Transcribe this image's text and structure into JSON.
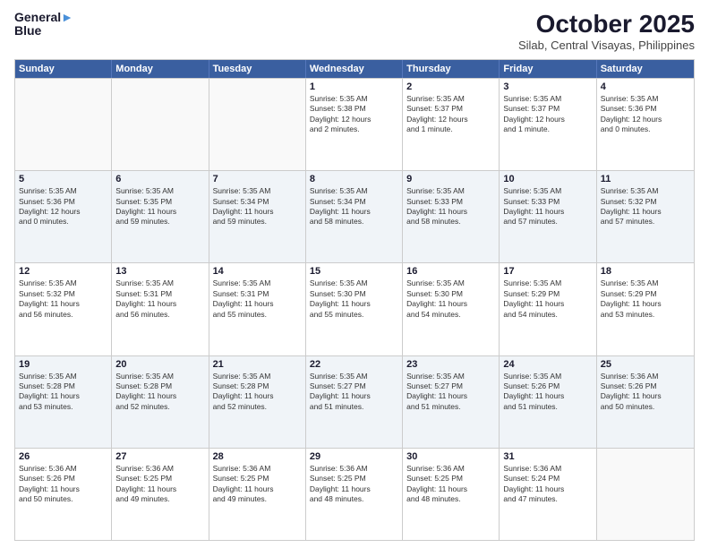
{
  "header": {
    "logo_line1": "General",
    "logo_line2": "Blue",
    "month": "October 2025",
    "location": "Silab, Central Visayas, Philippines"
  },
  "weekdays": [
    "Sunday",
    "Monday",
    "Tuesday",
    "Wednesday",
    "Thursday",
    "Friday",
    "Saturday"
  ],
  "rows": [
    [
      {
        "day": "",
        "info": ""
      },
      {
        "day": "",
        "info": ""
      },
      {
        "day": "",
        "info": ""
      },
      {
        "day": "1",
        "info": "Sunrise: 5:35 AM\nSunset: 5:38 PM\nDaylight: 12 hours\nand 2 minutes."
      },
      {
        "day": "2",
        "info": "Sunrise: 5:35 AM\nSunset: 5:37 PM\nDaylight: 12 hours\nand 1 minute."
      },
      {
        "day": "3",
        "info": "Sunrise: 5:35 AM\nSunset: 5:37 PM\nDaylight: 12 hours\nand 1 minute."
      },
      {
        "day": "4",
        "info": "Sunrise: 5:35 AM\nSunset: 5:36 PM\nDaylight: 12 hours\nand 0 minutes."
      }
    ],
    [
      {
        "day": "5",
        "info": "Sunrise: 5:35 AM\nSunset: 5:36 PM\nDaylight: 12 hours\nand 0 minutes."
      },
      {
        "day": "6",
        "info": "Sunrise: 5:35 AM\nSunset: 5:35 PM\nDaylight: 11 hours\nand 59 minutes."
      },
      {
        "day": "7",
        "info": "Sunrise: 5:35 AM\nSunset: 5:34 PM\nDaylight: 11 hours\nand 59 minutes."
      },
      {
        "day": "8",
        "info": "Sunrise: 5:35 AM\nSunset: 5:34 PM\nDaylight: 11 hours\nand 58 minutes."
      },
      {
        "day": "9",
        "info": "Sunrise: 5:35 AM\nSunset: 5:33 PM\nDaylight: 11 hours\nand 58 minutes."
      },
      {
        "day": "10",
        "info": "Sunrise: 5:35 AM\nSunset: 5:33 PM\nDaylight: 11 hours\nand 57 minutes."
      },
      {
        "day": "11",
        "info": "Sunrise: 5:35 AM\nSunset: 5:32 PM\nDaylight: 11 hours\nand 57 minutes."
      }
    ],
    [
      {
        "day": "12",
        "info": "Sunrise: 5:35 AM\nSunset: 5:32 PM\nDaylight: 11 hours\nand 56 minutes."
      },
      {
        "day": "13",
        "info": "Sunrise: 5:35 AM\nSunset: 5:31 PM\nDaylight: 11 hours\nand 56 minutes."
      },
      {
        "day": "14",
        "info": "Sunrise: 5:35 AM\nSunset: 5:31 PM\nDaylight: 11 hours\nand 55 minutes."
      },
      {
        "day": "15",
        "info": "Sunrise: 5:35 AM\nSunset: 5:30 PM\nDaylight: 11 hours\nand 55 minutes."
      },
      {
        "day": "16",
        "info": "Sunrise: 5:35 AM\nSunset: 5:30 PM\nDaylight: 11 hours\nand 54 minutes."
      },
      {
        "day": "17",
        "info": "Sunrise: 5:35 AM\nSunset: 5:29 PM\nDaylight: 11 hours\nand 54 minutes."
      },
      {
        "day": "18",
        "info": "Sunrise: 5:35 AM\nSunset: 5:29 PM\nDaylight: 11 hours\nand 53 minutes."
      }
    ],
    [
      {
        "day": "19",
        "info": "Sunrise: 5:35 AM\nSunset: 5:28 PM\nDaylight: 11 hours\nand 53 minutes."
      },
      {
        "day": "20",
        "info": "Sunrise: 5:35 AM\nSunset: 5:28 PM\nDaylight: 11 hours\nand 52 minutes."
      },
      {
        "day": "21",
        "info": "Sunrise: 5:35 AM\nSunset: 5:28 PM\nDaylight: 11 hours\nand 52 minutes."
      },
      {
        "day": "22",
        "info": "Sunrise: 5:35 AM\nSunset: 5:27 PM\nDaylight: 11 hours\nand 51 minutes."
      },
      {
        "day": "23",
        "info": "Sunrise: 5:35 AM\nSunset: 5:27 PM\nDaylight: 11 hours\nand 51 minutes."
      },
      {
        "day": "24",
        "info": "Sunrise: 5:35 AM\nSunset: 5:26 PM\nDaylight: 11 hours\nand 51 minutes."
      },
      {
        "day": "25",
        "info": "Sunrise: 5:36 AM\nSunset: 5:26 PM\nDaylight: 11 hours\nand 50 minutes."
      }
    ],
    [
      {
        "day": "26",
        "info": "Sunrise: 5:36 AM\nSunset: 5:26 PM\nDaylight: 11 hours\nand 50 minutes."
      },
      {
        "day": "27",
        "info": "Sunrise: 5:36 AM\nSunset: 5:25 PM\nDaylight: 11 hours\nand 49 minutes."
      },
      {
        "day": "28",
        "info": "Sunrise: 5:36 AM\nSunset: 5:25 PM\nDaylight: 11 hours\nand 49 minutes."
      },
      {
        "day": "29",
        "info": "Sunrise: 5:36 AM\nSunset: 5:25 PM\nDaylight: 11 hours\nand 48 minutes."
      },
      {
        "day": "30",
        "info": "Sunrise: 5:36 AM\nSunset: 5:25 PM\nDaylight: 11 hours\nand 48 minutes."
      },
      {
        "day": "31",
        "info": "Sunrise: 5:36 AM\nSunset: 5:24 PM\nDaylight: 11 hours\nand 47 minutes."
      },
      {
        "day": "",
        "info": ""
      }
    ]
  ]
}
